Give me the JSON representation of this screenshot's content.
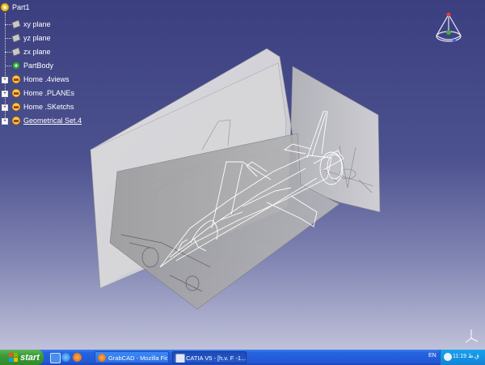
{
  "tree": {
    "root": "Part1",
    "items": [
      {
        "label": "xy plane",
        "icon": "plane-icon"
      },
      {
        "label": "yz plane",
        "icon": "plane-icon"
      },
      {
        "label": "zx plane",
        "icon": "plane-icon"
      },
      {
        "label": "PartBody",
        "icon": "gear-body-icon"
      },
      {
        "label": "Home .4views",
        "icon": "geometrical-set-icon"
      },
      {
        "label": "Home .PLANEs",
        "icon": "geometrical-set-icon"
      },
      {
        "label": "Home .SKetchs",
        "icon": "geometrical-set-icon"
      },
      {
        "label": "Geometrical Set.4",
        "icon": "geometrical-set-icon"
      }
    ]
  },
  "taskbar": {
    "start_label": "start",
    "tasks": [
      {
        "label": "GrabCAD - Mozilla Fir...",
        "icon": "firefox-icon"
      },
      {
        "label": "CATIA V5 - [h.v. F -1....",
        "icon": "catia-icon"
      }
    ],
    "language": "EN",
    "clock": "11:19 ق.ظ"
  },
  "colors": {
    "viewport_top": "#3b3f80",
    "viewport_bottom": "#bfc1d9",
    "taskbar": "#2358d6",
    "start": "#3b9b37"
  }
}
